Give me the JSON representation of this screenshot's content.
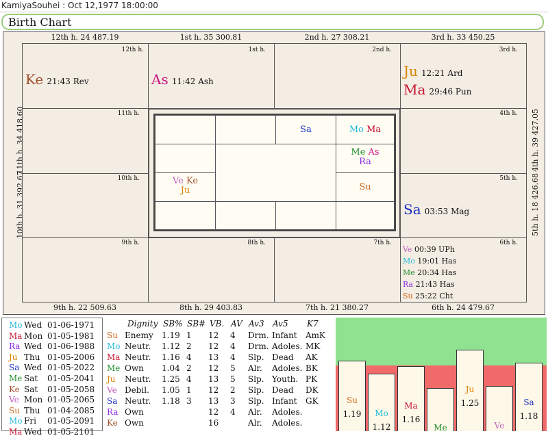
{
  "window": {
    "title": "KamiyaSouhei : Oct 12,1977 18:00:00"
  },
  "chart_title": "Birth Chart",
  "colors": {
    "Su": "#d2691e",
    "Mo": "#1fb8d8",
    "Ma": "#c8102e",
    "Me": "#1e8c2a",
    "Ju": "#d98200",
    "Ve": "#c060c0",
    "Sa": "#1a2ec0",
    "Ra": "#8a2be2",
    "Ke": "#a0522d",
    "As": "#c71585",
    "bar_bg_green": "#8fe28f",
    "bar_bg_red": "#f06a6a"
  },
  "outer_labels": {
    "top": [
      "12th h.  24  487.19",
      "1st h.  35  300.81",
      "2nd h.  27  308.21",
      "3rd h.  33  450.25"
    ],
    "bottom": [
      "9th h.  22  509.63",
      "8th h.  29  403.83",
      "7th h.  21  380.27",
      "6th h.  24  479.67"
    ],
    "left": [
      "11th h.  34  418.60",
      "10th h.  31  392.67"
    ],
    "right": [
      "4th h.  39  427.05",
      "5th h.  18  426.68"
    ]
  },
  "houses": {
    "h12": {
      "tag": "12th h.",
      "big": [
        {
          "p": "Ke",
          "deg": "21:43 Rev"
        }
      ]
    },
    "h1": {
      "tag": "1st h.",
      "big": [
        {
          "p": "As",
          "deg": "11:42 Ash"
        }
      ]
    },
    "h2": {
      "tag": "2nd h."
    },
    "h3": {
      "tag": "3rd h.",
      "big": [
        {
          "p": "Ju",
          "deg": "12:21 Ard"
        },
        {
          "p": "Ma",
          "deg": "29:46 Pun"
        }
      ]
    },
    "h11": {
      "tag": "11th h."
    },
    "h4": {
      "tag": "4th h."
    },
    "h10": {
      "tag": "10th h."
    },
    "h5": {
      "tag": "5th h.",
      "big": [
        {
          "p": "Sa",
          "deg": "03:53 Mag"
        }
      ]
    },
    "h9": {
      "tag": "9th h."
    },
    "h8": {
      "tag": "8th h."
    },
    "h7": {
      "tag": "7th h."
    },
    "h6": {
      "tag": "6th h.",
      "rows": [
        {
          "p": "Ve",
          "deg": "00:39  UPh"
        },
        {
          "p": "Mo",
          "deg": "19:01  Has"
        },
        {
          "p": "Me",
          "deg": "20:34  Has"
        },
        {
          "p": "Ra",
          "deg": "21:43  Has"
        },
        {
          "p": "Su",
          "deg": "25:22  Cht"
        }
      ]
    }
  },
  "inner_chart": {
    "sa": "Sa",
    "mo_ma": [
      "Mo",
      "Ma"
    ],
    "me_as": [
      "Me",
      "As"
    ],
    "ra": "Ra",
    "ve_ke": [
      "Ve",
      "Ke"
    ],
    "ju": "Ju",
    "su": "Su"
  },
  "dasha": [
    {
      "p": "Mo",
      "day": "Wed",
      "date": "01-06-1971"
    },
    {
      "p": "Ma",
      "day": "Mon",
      "date": "01-05-1981"
    },
    {
      "p": "Ra",
      "day": "Wed",
      "date": "01-06-1988"
    },
    {
      "p": "Ju",
      "day": "Thu",
      "date": "01-05-2006"
    },
    {
      "p": "Sa",
      "day": "Wed",
      "date": "01-05-2022"
    },
    {
      "p": "Me",
      "day": "Sat",
      "date": "01-05-2041"
    },
    {
      "p": "Ke",
      "day": "Sat",
      "date": "01-05-2058"
    },
    {
      "p": "Ve",
      "day": "Mon",
      "date": "01-05-2065"
    },
    {
      "p": "Su",
      "day": "Thu",
      "date": "01-04-2085"
    },
    {
      "p": "Mo",
      "day": "Fri",
      "date": "01-05-2091"
    },
    {
      "p": "Ma",
      "day": "Wed",
      "date": "01-05-2101"
    }
  ],
  "strength_table": {
    "headers": [
      "Dignity",
      "SB%",
      "SB#",
      "VB.",
      "AV",
      "Av3",
      "Av5",
      "K7"
    ],
    "rows": [
      {
        "p": "Su",
        "dignity": "Enemy",
        "sbp": "1.19",
        "sbn": "1",
        "vb": "12",
        "av": "4",
        "av3": "Drm.",
        "av5": "Infant",
        "k7": "AmK"
      },
      {
        "p": "Mo",
        "dignity": "Neutr.",
        "sbp": "1.12",
        "sbn": "2",
        "vb": "12",
        "av": "4",
        "av3": "Drm.",
        "av5": "Adoles.",
        "k7": "MK"
      },
      {
        "p": "Ma",
        "dignity": "Neutr.",
        "sbp": "1.16",
        "sbn": "4",
        "vb": "13",
        "av": "4",
        "av3": "Slp.",
        "av5": "Dead",
        "k7": "AK"
      },
      {
        "p": "Me",
        "dignity": "Own",
        "sbp": "1.04",
        "sbn": "2",
        "vb": "12",
        "av": "5",
        "av3": "Alr.",
        "av5": "Adoles.",
        "k7": "BK"
      },
      {
        "p": "Ju",
        "dignity": "Neutr.",
        "sbp": "1.25",
        "sbn": "4",
        "vb": "13",
        "av": "5",
        "av3": "Slp.",
        "av5": "Youth.",
        "k7": "PK"
      },
      {
        "p": "Ve",
        "dignity": "Debil.",
        "sbp": "1.05",
        "sbn": "1",
        "vb": "12",
        "av": "2",
        "av3": "Slp.",
        "av5": "Dead",
        "k7": "DK"
      },
      {
        "p": "Sa",
        "dignity": "Neutr.",
        "sbp": "1.18",
        "sbn": "3",
        "vb": "13",
        "av": "3",
        "av3": "Slp.",
        "av5": "Infant",
        "k7": "GK"
      },
      {
        "p": "Ra",
        "dignity": "Own",
        "sbp": "",
        "sbn": "",
        "vb": "12",
        "av": "4",
        "av3": "Alr.",
        "av5": "Adoles.",
        "k7": ""
      },
      {
        "p": "Ke",
        "dignity": "Own",
        "sbp": "",
        "sbn": "",
        "vb": "16",
        "av": "",
        "av3": "Alr.",
        "av5": "Adoles.",
        "k7": ""
      }
    ]
  },
  "chart_data": {
    "type": "bar",
    "categories": [
      "Su",
      "Mo",
      "Ma",
      "Me",
      "Ju",
      "Ve",
      "Sa"
    ],
    "values": [
      1.19,
      1.12,
      1.16,
      1.04,
      1.25,
      1.05,
      1.18
    ],
    "value_labels": [
      "1.19",
      "1.12",
      "1.16",
      "1.04",
      "1.25",
      "1.05",
      "1.18"
    ],
    "threshold": 1.0,
    "ylim": [
      0.8,
      1.43
    ]
  }
}
